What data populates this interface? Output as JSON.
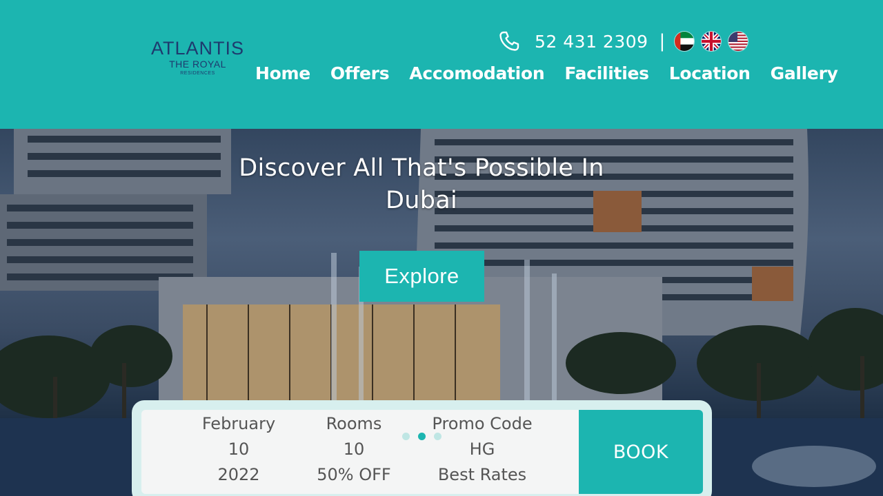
{
  "logo": {
    "line1": "ATLANTIS",
    "line2": "THE ROYAL",
    "line3": "RESIDENCES"
  },
  "contact": {
    "phone": "52 431 2309",
    "separator": "|"
  },
  "languages": [
    "ae-flag-icon",
    "uk-flag-icon",
    "us-flag-icon"
  ],
  "nav": {
    "items": [
      {
        "label": "Home"
      },
      {
        "label": "Offers"
      },
      {
        "label": "Accomodation"
      },
      {
        "label": "Facilities"
      },
      {
        "label": "Location"
      },
      {
        "label": "Gallery"
      }
    ]
  },
  "hero": {
    "title": "Discover All That's Possible In Dubai",
    "explore_label": "Explore"
  },
  "booking": {
    "date": {
      "month": "February",
      "day": "10",
      "year": "2022"
    },
    "rooms": {
      "label": "Rooms",
      "count": "10",
      "offer": "50% OFF"
    },
    "promo": {
      "label": "Promo Code",
      "code": "HG",
      "note": "Best Rates"
    },
    "book_label": "BOOK",
    "carousel": {
      "count": 3,
      "active": 2
    }
  },
  "colors": {
    "brand": "#1cb5b0",
    "logo": "#1e3a6e",
    "panel": "#d7efee"
  }
}
